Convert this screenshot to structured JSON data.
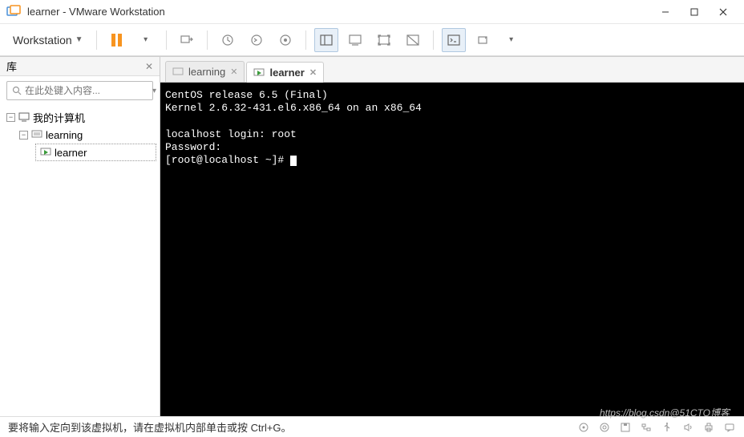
{
  "window": {
    "title": "learner - VMware Workstation"
  },
  "toolbar": {
    "menu_label": "Workstation"
  },
  "sidebar": {
    "title": "库",
    "search_placeholder": "在此处键入内容...",
    "root": "我的计算机",
    "items": [
      "learning",
      "learner"
    ]
  },
  "tabs": [
    {
      "label": "learning",
      "active": false
    },
    {
      "label": "learner",
      "active": true
    }
  ],
  "terminal": {
    "lines": [
      "CentOS release 6.5 (Final)",
      "Kernel 2.6.32-431.el6.x86_64 on an x86_64",
      "",
      "localhost login: root",
      "Password:",
      "[root@localhost ~]# "
    ]
  },
  "statusbar": {
    "message": "要将输入定向到该虚拟机，请在虚拟机内部单击或按 Ctrl+G。"
  },
  "watermark": "https://blog.csdn@51CTO博客"
}
